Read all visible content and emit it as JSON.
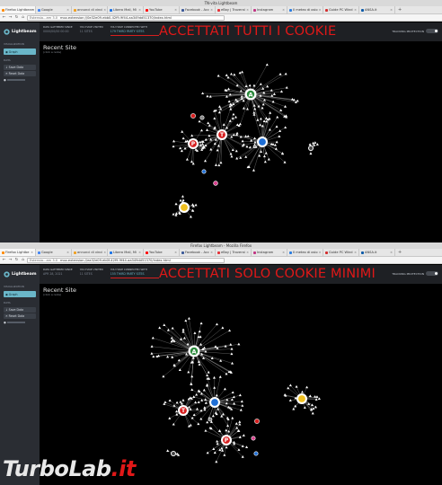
{
  "top": {
    "window_title": "TN-vita Lightbeam",
    "tabs": [
      "Firefox Lightbeam",
      "Google",
      "annunci di vinci",
      "Libero Mail, Mi",
      "YouTube",
      "Facebook - Acc",
      "eBay | Troverai",
      "Instagram",
      "Il meteo di osio",
      "Guide PC Wind",
      "ANSA.it"
    ],
    "url_prefix": "Estensio...am 3.0",
    "url": "moz-extension://0e32e09-ebb0-42f9-9f44-aa349dd51370/index.html",
    "banner": "ACCETTATI TUTTI I COOKIE",
    "stats": [
      {
        "label": "DATA GATHERED SINCE",
        "value": "0000/00/00 00:00"
      },
      {
        "label": "YOU HAVE VISITED",
        "value": "11 SITES"
      },
      {
        "label": "YOU HAVE CONNECTED WITH",
        "value": "179 THIRD PARTY SITES"
      }
    ]
  },
  "bottom": {
    "window_title": "Firefox Lightbeam - Mozilla Firefox",
    "tabs": [
      "Firefox Lightbe",
      "Google",
      "annunci di vinci",
      "Libero Mail, Mi",
      "YouTube",
      "Facebook - Acc",
      "eBay | Troverai",
      "Instagram",
      "Il meteo di osio",
      "Guide PC Wind",
      "ANSA.it"
    ],
    "url_prefix": "Estensio...am 3.0",
    "url": "moz-extension://ea32e09-eb0f-42f9-9f44-aa349dd51370/index.html",
    "banner": "ACCETTATI SOLO COOKIE MINIMI",
    "stats": [
      {
        "label": "DATA GATHERED SINCE",
        "value": "APR 28, 2021"
      },
      {
        "label": "YOU HAVE VISITED",
        "value": "11 SITES"
      },
      {
        "label": "YOU HAVE CONNECTED WITH",
        "value": "155 THIRD PARTY SITES"
      }
    ]
  },
  "common": {
    "logo_text": "Lightbeam",
    "sidebar_section_1": "VISUALIZATION",
    "sidebar_section_2": "DATA",
    "sidebar_btn_graph": "Graph",
    "sidebar_btn_save": "Save Data",
    "sidebar_btn_reset": "Reset Data",
    "tracking_protection": "TRACKING PROTECTION",
    "graph_title": "Recent Site",
    "graph_sub": "(click a node)"
  },
  "watermark": {
    "part1": "TurboLab",
    "part2": ".it"
  }
}
